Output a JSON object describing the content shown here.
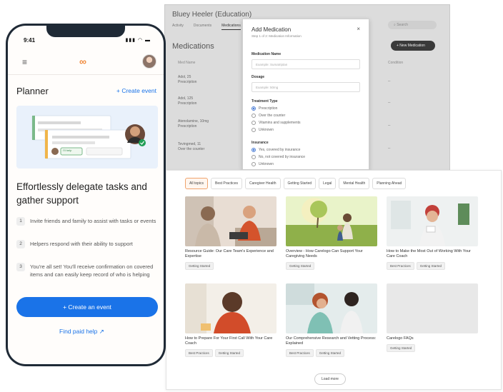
{
  "desktop": {
    "title": "Bluey Heeler (Education)",
    "nav": [
      "Activity",
      "Documents",
      "Medications"
    ],
    "search_placeholder": "Search",
    "section_title": "Medications",
    "new_button": "+ New Medication",
    "table_headers": [
      "Med Name",
      "Condition"
    ],
    "rows": [
      {
        "name": "Adol, 25",
        "type": "Prescription"
      },
      {
        "name": "Adol, 125",
        "type": "Prescription"
      },
      {
        "name": "Atenolamine, 10mg",
        "type": "Prescription"
      },
      {
        "name": "Tevingmed, 11",
        "type": "Over the counter"
      }
    ]
  },
  "modal": {
    "title": "Add Medication",
    "close": "×",
    "subtitle": "Step 1 of 2: Medication Information",
    "fields": [
      {
        "label": "Medication Name",
        "placeholder": "Example: Sumatriptan"
      },
      {
        "label": "Dosage",
        "placeholder": "Example: 50mg"
      }
    ],
    "treatment_label": "Treatment Type",
    "treatment_options": [
      "Prescription",
      "Over the counter",
      "Vitamins and supplements",
      "Unknown"
    ],
    "insurance_label": "Insurance",
    "insurance_options": [
      "Yes, covered by insurance",
      "No, not covered by insurance",
      "Unknown"
    ]
  },
  "resources": {
    "chips": [
      "All topics",
      "Best Practices",
      "Caregiver Health",
      "Getting Started",
      "Legal",
      "Mental Health",
      "Planning Ahead"
    ],
    "cards": [
      {
        "title": "Resource Guide: Our Care Team's Experience and Expertise",
        "tags": [
          "Getting Started"
        ]
      },
      {
        "title": "Overview - How Carelogo Can Support Your Caregiving Needs",
        "tags": [
          "Getting Started"
        ]
      },
      {
        "title": "How to Make the Most Out of Working With Your Care Coach",
        "tags": [
          "Best Practices",
          "Getting Started"
        ]
      },
      {
        "title": "How to Prepare For Your First Call With Your Care Coach",
        "tags": [
          "Best Practices",
          "Getting Started"
        ]
      },
      {
        "title": "Our Comprehensive Research and Vetting Process: Explained",
        "tags": [
          "Best Practices",
          "Getting Started"
        ]
      },
      {
        "title": "Carelogo FAQs",
        "tags": [
          "Getting Started"
        ]
      }
    ],
    "load_more": "Load more"
  },
  "phone": {
    "time": "9:41",
    "status_icons": "▮▮▮ ◠ ▬",
    "logo": "∞",
    "menu_icon": "≡",
    "planner_title": "Planner",
    "create_event_link": "+ Create event",
    "illus_chip": "I'll help",
    "headline": "Effortlessly delegate tasks and gather support",
    "steps": [
      {
        "num": "1",
        "text": "Invite friends and family to assist with tasks or events"
      },
      {
        "num": "2",
        "text": "Helpers respond with their ability to support"
      },
      {
        "num": "3",
        "text": "You're all set! You'll receive confirmation on covered items and can easily keep record of who is helping"
      }
    ],
    "cta": "+ Create an event",
    "paid_help": "Find paid help ↗"
  }
}
